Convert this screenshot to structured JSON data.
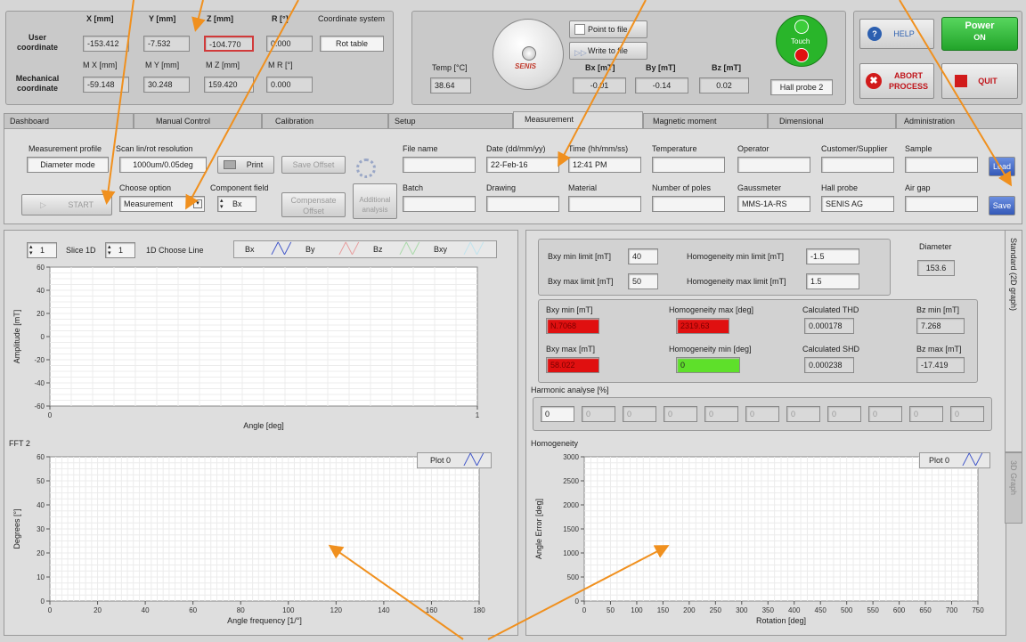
{
  "coords": {
    "headers": [
      "X [mm]",
      "Y [mm]",
      "Z [mm]",
      "R [°]"
    ],
    "mech_headers": [
      "M X [mm]",
      "M Y [mm]",
      "M Z [mm]",
      "M R [°]"
    ],
    "user_label": "User coordinate",
    "mech_label": "Mechanical coordinate",
    "user_values": [
      "-153.412",
      "-7.532",
      "-104.770",
      "0.000"
    ],
    "mech_values": [
      "-59.148",
      "30.248",
      "159.420",
      "0.000"
    ],
    "system_label": "Coordinate system",
    "system_value": "Rot table"
  },
  "sensor": {
    "temp_label": "Temp [°C]",
    "temp_value": "38.64",
    "logo": "SENIS",
    "point_to_file": "Point to file",
    "write_to_file": "Write to file",
    "b_labels": [
      "Bx [mT]",
      "By [mT]",
      "Bz [mT]"
    ],
    "b_values": [
      "-0.01",
      "-0.14",
      "0.02"
    ],
    "touch": "Touch",
    "probe": "Hall probe 2"
  },
  "controls": {
    "help": "HELP",
    "power": "Power",
    "power_state": "ON",
    "abort": "ABORT PROCESS",
    "quit": "QUIT"
  },
  "tabs": [
    "Dashboard",
    "Manual Control",
    "Calibration",
    "Setup",
    "Measurement",
    "Magnetic moment",
    "Dimensional",
    "Administration"
  ],
  "meas": {
    "profile_label": "Measurement profile",
    "profile_value": "Diameter mode",
    "scan_label": "Scan lin/rot resolution",
    "scan_value": "1000um/0.05deg",
    "print": "Print",
    "save_offset": "Save Offset",
    "start": "START",
    "choose_label": "Choose option",
    "choose_value": "Measurement",
    "component_label": "Component field",
    "component_value": "Bx",
    "compensate": "Compensate Offset",
    "additional": "Additional analysis",
    "load": "Load",
    "save": "Save"
  },
  "meta_row1": [
    {
      "label": "File name",
      "value": ""
    },
    {
      "label": "Date (dd/mm/yy)",
      "value": "22-Feb-16"
    },
    {
      "label": "Time (hh/mm/ss)",
      "value": "12:41 PM"
    },
    {
      "label": "Temperature",
      "value": ""
    },
    {
      "label": "Operator",
      "value": ""
    },
    {
      "label": "Customer/Supplier",
      "value": ""
    },
    {
      "label": "Sample",
      "value": ""
    }
  ],
  "meta_row2": [
    {
      "label": "Batch",
      "value": ""
    },
    {
      "label": "Drawing",
      "value": ""
    },
    {
      "label": "Material",
      "value": ""
    },
    {
      "label": "Number of poles",
      "value": ""
    },
    {
      "label": "Gaussmeter",
      "value": "MMS-1A-RS"
    },
    {
      "label": "Hall probe",
      "value": "SENIS AG"
    },
    {
      "label": "Air gap",
      "value": ""
    }
  ],
  "plot1": {
    "slice_value": "1",
    "slice_label": "Slice 1D",
    "line_value": "1",
    "line_label": "1D Choose Line",
    "legend": [
      "Bx",
      "By",
      "Bz",
      "Bxy"
    ],
    "ylabel": "Amplitude [mT]",
    "xlabel": "Angle [deg]",
    "yticks": [
      "60",
      "40",
      "20",
      "0",
      "-20",
      "-40",
      "-60"
    ],
    "xticks": [
      "0",
      "1"
    ]
  },
  "plot2": {
    "title": "FFT 2",
    "legend": "Plot 0",
    "ylabel": "Degrees [°]",
    "xlabel": "Angle frequency [1/°]",
    "yticks": [
      "60",
      "50",
      "40",
      "30",
      "20",
      "10",
      "0"
    ],
    "xticks": [
      "0",
      "20",
      "40",
      "60",
      "80",
      "100",
      "120",
      "140",
      "160",
      "180"
    ]
  },
  "limits": {
    "bxy_min_label": "Bxy min limit [mT]",
    "bxy_min": "40",
    "bxy_max_label": "Bxy max limit [mT]",
    "bxy_max": "50",
    "hom_min_label": "Homogeneity min limit [mT]",
    "hom_min": "-1.5",
    "hom_max_label": "Homogeneity max limit [mT]",
    "hom_max": "1.5",
    "diameter_label": "Diameter",
    "diameter": "153.6"
  },
  "results": {
    "bxy_min_label": "Bxy min [mT]",
    "bxy_min": "N.7068",
    "bxy_max_label": "Bxy max [mT]",
    "bxy_max": "58.022",
    "hom_max_label": "Homogeneity max [deg]",
    "hom_max": "2319.63",
    "hom_min_label": "Homogeneity min [deg]",
    "hom_min": "0",
    "thd_label": "Calculated THD",
    "thd": "0.000178",
    "shd_label": "Calculated SHD",
    "shd": "0.000238",
    "bz_min_label": "Bz min [mT]",
    "bz_min": "7.268",
    "bz_max_label": "Bz max [mT]",
    "bz_max": "-17.419"
  },
  "harmonic": {
    "label": "Harmonic analyse [%]",
    "values": [
      "0",
      "0",
      "0",
      "0",
      "0",
      "0",
      "0",
      "0",
      "0",
      "0",
      "0"
    ]
  },
  "plot3": {
    "title": "Homogeneity",
    "legend": "Plot 0",
    "ylabel": "Angle Error [deg]",
    "xlabel": "Rotation [deg]",
    "yticks": [
      "3000",
      "2500",
      "2000",
      "1500",
      "1000",
      "500",
      "0"
    ],
    "xticks": [
      "0",
      "50",
      "100",
      "150",
      "200",
      "250",
      "300",
      "350",
      "400",
      "450",
      "500",
      "550",
      "600",
      "650",
      "700",
      "750"
    ]
  },
  "side_tabs": {
    "standard": "Standard (2D graph)",
    "graph3d": "3D Graph"
  },
  "colors": {
    "arrow": "#f0901e",
    "power_green": "#2bbb3a",
    "alarm_red": "#e01010",
    "ok_green": "#5ee02a",
    "highlight_red": "#d13a3a"
  }
}
